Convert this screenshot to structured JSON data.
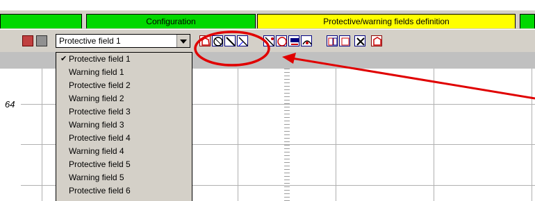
{
  "tabs": [
    {
      "label": "",
      "color": "#00d800"
    },
    {
      "label": "Configuration",
      "color": "#00d800"
    },
    {
      "label": "Protective/warning fields definition",
      "color": "#ffff00"
    },
    {
      "label": "",
      "color": "#00d800"
    }
  ],
  "field_select": {
    "selected": "Protective field 1",
    "options": [
      {
        "label": "Protective field 1",
        "checked": true
      },
      {
        "label": "Warning field 1",
        "checked": false
      },
      {
        "label": "Protective field 2",
        "checked": false
      },
      {
        "label": "Warning field 2",
        "checked": false
      },
      {
        "label": "Protective field 3",
        "checked": false
      },
      {
        "label": "Warning field 3",
        "checked": false
      },
      {
        "label": "Protective field 4",
        "checked": false
      },
      {
        "label": "Warning field 4",
        "checked": false
      },
      {
        "label": "Protective field 5",
        "checked": false
      },
      {
        "label": "Warning field 5",
        "checked": false
      },
      {
        "label": "Protective field 6",
        "checked": false
      }
    ],
    "check_glyph": "✔"
  },
  "toolbar_icons": [
    "save-icon",
    "print-icon",
    "draw-polygon-icon",
    "draw-circle-icon",
    "draw-segment-icon",
    "draw-line-icon",
    "edit-line-icon",
    "edit-circle-icon",
    "edit-rectangle-icon",
    "edit-segment-icon",
    "copy-field-icon",
    "paste-field-icon",
    "delete-field-icon",
    "field-properties-icon"
  ],
  "grid": {
    "axis_value": "64"
  },
  "annotation": {
    "color": "#e00000"
  }
}
